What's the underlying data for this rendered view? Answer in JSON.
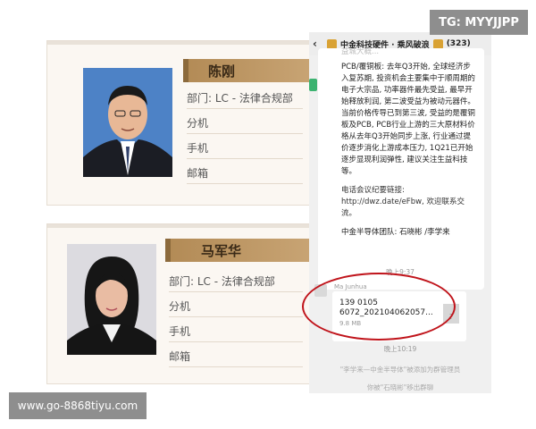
{
  "watermark_top": "TG: MYYJJPP",
  "watermark_bottom": "www.go-8868tiyu.com",
  "cards": [
    {
      "name": "陈刚",
      "dept": "部门: LC - 法律合规部",
      "ext": "分机",
      "mobile": "手机",
      "email": "邮箱"
    },
    {
      "name": "马军华",
      "dept": "部门: LC - 法律合规部",
      "ext": "分机",
      "mobile": "手机",
      "email": "邮箱"
    }
  ],
  "chat": {
    "back": "‹",
    "title": "中金科技硬件 · 乘风破浪",
    "count": "(323)",
    "faded_line": "益城大概...",
    "msg_p1": "PCB/覆铜板: 去年Q3开始, 全球经济步入复苏期, 投资机会主要集中于顺周期的电子大宗品, 功率器件最先受益, 最早开始释放利润, 第二波受益为被动元器件。当前价格传导已到第三波, 受益的是覆铜板及PCB, PCB行业上游的三大原材料价格从去年Q3开始同步上涨, 行业通过提价逐步消化上游成本压力, 1Q21已开始逐步显现利润弹性, 建议关注生益科技等。",
    "msg_p2": "电话会议纪要链接: http://dwz.date/eFbw, 欢迎联系交流。",
    "msg_p3": "中金半导体团队: 石晓彬 /李学来",
    "time1": "晚上9:37",
    "sender": "Ma Junhua",
    "file_line1": "139 0105",
    "file_line2": "6072_202104062057...",
    "file_size": "9.8 MB",
    "file_icon": "?",
    "time2": "晚上10:19",
    "sys1": "\"李学来—中金半导体\"被添加为群管理员",
    "sys2": "你被\"石晓彬\"移出群聊"
  }
}
